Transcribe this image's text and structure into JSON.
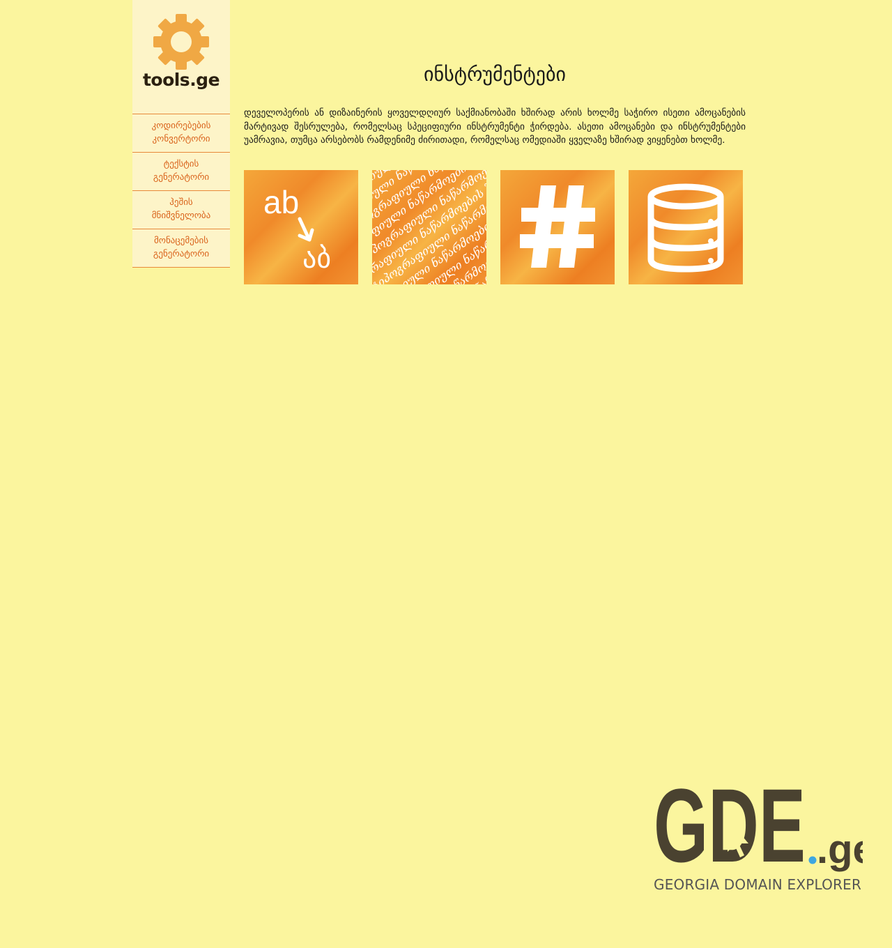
{
  "site": {
    "logo_text": "tools.ge"
  },
  "sidebar": {
    "items": [
      {
        "line1": "კოდირებების",
        "line2": "კონვერტორი"
      },
      {
        "line1": "ტექსტის",
        "line2": "გენერატორი"
      },
      {
        "line1": "ჰეშის",
        "line2": "მნიშვნელობა"
      },
      {
        "line1": "მონაცემების",
        "line2": "გენერატორი"
      }
    ]
  },
  "main": {
    "title": "ინსტრუმენტები",
    "intro": "დეველოპერის ან დიზაინერის ყოველდღიურ საქმიანობაში ხშირად არის ხოლმე საჭირო ისეთი ამოცანების მარტივად შესრულება, რომელსაც სპეციფიური ინსტრუმენტი ჭირდება. ასეთი ამოცანები და ინსტრუმენტები უამრავია, თუმცა არსებობს რამდენიმე ძირითადი, რომელსაც ომედიაში ყველაზე ხშირად ვიყენებთ ხოლმე.",
    "tiles": [
      {
        "icon": "encoding-convert-icon",
        "top_text": "ab",
        "bottom_text": "აბ"
      },
      {
        "icon": "text-generator-icon",
        "pattern_text": "ის ტიპოგრაფიული ნაწარმოების შემქმნელებს, რეალური შინაარსის დამატებამდე გადაეხედათ, თუ როგორი იქნებოდა ტექსტი. ხშირად შემთხვევაში ქართულ სტრუქტურას"
      },
      {
        "icon": "hash-icon",
        "symbol": "#"
      },
      {
        "icon": "database-icon"
      }
    ]
  },
  "footer": {
    "brand": "GDE",
    "brand_suffix": ".ge",
    "brand_subtitle": "GEORGIA DOMAIN EXPLORER"
  },
  "colors": {
    "background": "#fbf59e",
    "sidebar": "#fdf4c8",
    "accent": "#e8893a",
    "nav_text": "#d9621a",
    "gear": "#f0a844",
    "brand_dark": "#4a4230",
    "brand_dot": "#3ea6e0"
  }
}
